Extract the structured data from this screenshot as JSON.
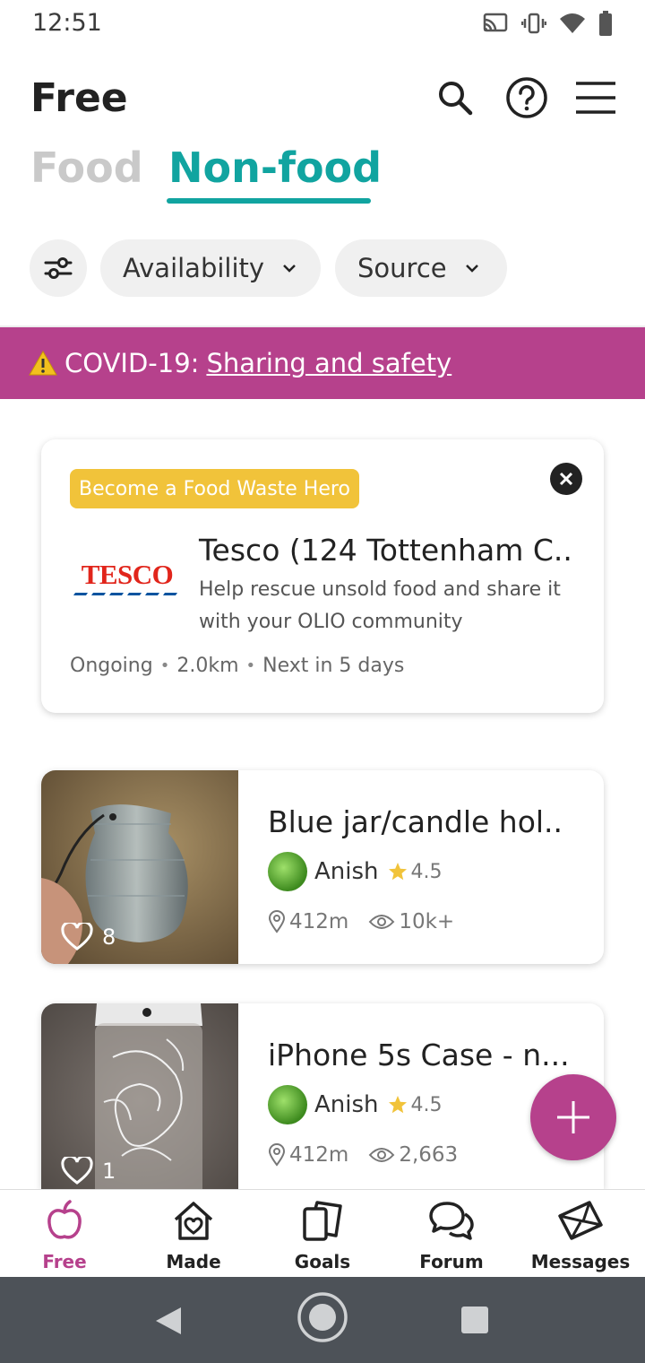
{
  "status_bar": {
    "time": "12:51"
  },
  "header": {
    "title": "Free"
  },
  "tabs": [
    {
      "label": "Food",
      "active": false
    },
    {
      "label": "Non-food",
      "active": true
    }
  ],
  "filters": [
    {
      "label": "Availability"
    },
    {
      "label": "Source"
    }
  ],
  "banner": {
    "prefix": "COVID-19:",
    "link": "Sharing and safety"
  },
  "promo": {
    "badge": "Become a Food Waste Hero",
    "logo_text": "TESCO",
    "title": "Tesco (124 Tottenham C..",
    "description": "Help rescue unsold food and share it with your OLIO community",
    "status": "Ongoing",
    "distance": "2.0km",
    "next": "Next in 5 days"
  },
  "listings": [
    {
      "title": "Blue jar/candle hol..",
      "user": "Anish",
      "rating": "4.5",
      "distance": "412m",
      "views": "10k+",
      "likes": "8"
    },
    {
      "title": "iPhone 5s Case - n...",
      "user": "Anish",
      "rating": "4.5",
      "distance": "412m",
      "views": "2,663",
      "likes": "1"
    }
  ],
  "bottom_nav": [
    {
      "label": "Free",
      "icon": "apple-icon",
      "active": true
    },
    {
      "label": "Made",
      "icon": "home-heart-icon",
      "active": false
    },
    {
      "label": "Goals",
      "icon": "goals-icon",
      "active": false
    },
    {
      "label": "Forum",
      "icon": "chat-bubbles-icon",
      "active": false
    },
    {
      "label": "Messages",
      "icon": "envelope-icon",
      "active": false
    }
  ],
  "colors": {
    "accent_teal": "#11a4a0",
    "brand_magenta": "#b6418c",
    "badge_yellow": "#f1c33a"
  }
}
